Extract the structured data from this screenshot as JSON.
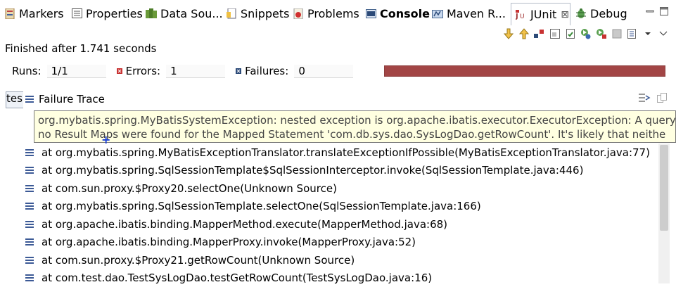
{
  "tabs": [
    {
      "label": "Markers",
      "icon": "markers-icon"
    },
    {
      "label": "Properties",
      "icon": "properties-icon"
    },
    {
      "label": "Data Sou...",
      "icon": "data-source-icon"
    },
    {
      "label": "Snippets",
      "icon": "snippets-icon"
    },
    {
      "label": "Problems",
      "icon": "problems-icon"
    },
    {
      "label": "Console",
      "icon": "console-icon"
    },
    {
      "label": "Maven R...",
      "icon": "maven-icon"
    },
    {
      "label": "JUnit",
      "icon": "junit-icon",
      "close": "⊠"
    },
    {
      "label": "Debug",
      "icon": "debug-icon"
    }
  ],
  "status": "Finished after 1.741 seconds",
  "counters": {
    "runs_label": "Runs:",
    "runs_value": "1/1",
    "errors_label": "Errors:",
    "errors_value": "1",
    "failures_label": "Failures:",
    "failures_value": "0"
  },
  "progress_color": "#a24545",
  "tree_stub": "tes",
  "trace": {
    "title": "Failure Trace",
    "tooltip_line1": "org.mybatis.spring.MyBatisSystemException: nested exception is org.apache.ibatis.executor.ExecutorException: A query",
    "tooltip_line2": "no Result Maps were found for the Mapped Statement 'com.db.sys.dao.SysLogDao.getRowCount'.  It's likely that neithe",
    "frames": [
      "at org.mybatis.spring.MyBatisExceptionTranslator.translateExceptionIfPossible(MyBatisExceptionTranslator.java:77)",
      "at org.mybatis.spring.SqlSessionTemplate$SqlSessionInterceptor.invoke(SqlSessionTemplate.java:446)",
      "at com.sun.proxy.$Proxy20.selectOne(Unknown Source)",
      "at org.mybatis.spring.SqlSessionTemplate.selectOne(SqlSessionTemplate.java:166)",
      "at org.apache.ibatis.binding.MapperMethod.execute(MapperMethod.java:68)",
      "at org.apache.ibatis.binding.MapperProxy.invoke(MapperProxy.java:52)",
      "at com.sun.proxy.$Proxy21.getRowCount(Unknown Source)",
      "at com.test.dao.TestSysLogDao.testGetRowCount(TestSysLogDao.java:16)"
    ]
  }
}
